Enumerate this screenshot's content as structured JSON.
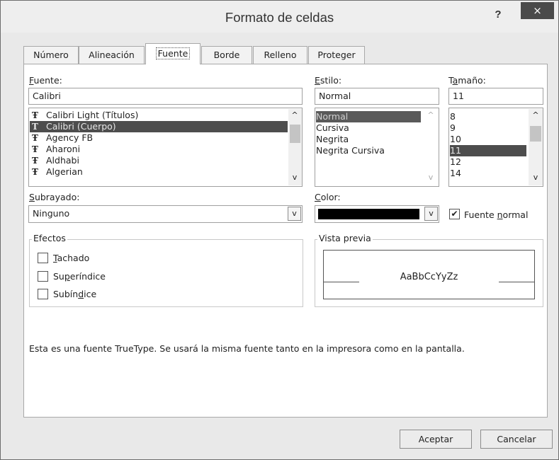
{
  "window": {
    "title": "Formato de celdas",
    "help_label": "?",
    "close_label": "×"
  },
  "tabs": [
    {
      "label": "Número"
    },
    {
      "label": "Alineación"
    },
    {
      "label": "Fuente"
    },
    {
      "label": "Borde"
    },
    {
      "label": "Relleno"
    },
    {
      "label": "Proteger"
    }
  ],
  "font": {
    "label_mnemonic": "F",
    "label_rest": "uente:",
    "value": "Calibri",
    "items": [
      {
        "icon": "Ŧ",
        "name": "Calibri Light (Títulos)"
      },
      {
        "icon": "T",
        "name": "Calibri (Cuerpo)"
      },
      {
        "icon": "Ŧ",
        "name": "Agency FB"
      },
      {
        "icon": "Ŧ",
        "name": "Aharoni"
      },
      {
        "icon": "Ŧ",
        "name": "Aldhabi"
      },
      {
        "icon": "Ŧ",
        "name": "Algerian"
      }
    ],
    "selected": "Calibri (Cuerpo)"
  },
  "style": {
    "label_mnemonic": "E",
    "label_rest": "stilo:",
    "value": "Normal",
    "items": [
      "Normal",
      "Cursiva",
      "Negrita",
      "Negrita Cursiva"
    ],
    "selected": "Normal"
  },
  "size": {
    "label_pre": "T",
    "label_mnemonic": "a",
    "label_rest": "maño:",
    "value": "11",
    "items": [
      "8",
      "9",
      "10",
      "11",
      "12",
      "14"
    ],
    "selected": "11"
  },
  "underline": {
    "label_mnemonic": "S",
    "label_rest": "ubrayado:",
    "value": "Ninguno"
  },
  "color": {
    "label_mnemonic": "C",
    "label_rest": "olor:",
    "swatch": "#000000"
  },
  "normal_font": {
    "label_pre": "Fuente ",
    "label_mnemonic": "n",
    "label_rest": "ormal",
    "checked": true
  },
  "effects": {
    "title": "Efectos",
    "items": [
      {
        "pre": "",
        "mnemonic": "T",
        "rest": "achado",
        "checked": false
      },
      {
        "pre": "Su",
        "mnemonic": "p",
        "rest": "eríndice",
        "checked": false
      },
      {
        "pre": "Subín",
        "mnemonic": "d",
        "rest": "ice",
        "checked": false
      }
    ]
  },
  "preview": {
    "title": "Vista previa",
    "sample": "AaBbCcYyZz"
  },
  "info_text": "Esta es una fuente TrueType. Se usará la misma fuente tanto en la impresora como en la pantalla.",
  "buttons": {
    "ok": "Aceptar",
    "cancel": "Cancelar"
  },
  "icons": {
    "scroll_up": "^",
    "scroll_down": "v",
    "dropdown": "⌄",
    "check": "✔"
  }
}
